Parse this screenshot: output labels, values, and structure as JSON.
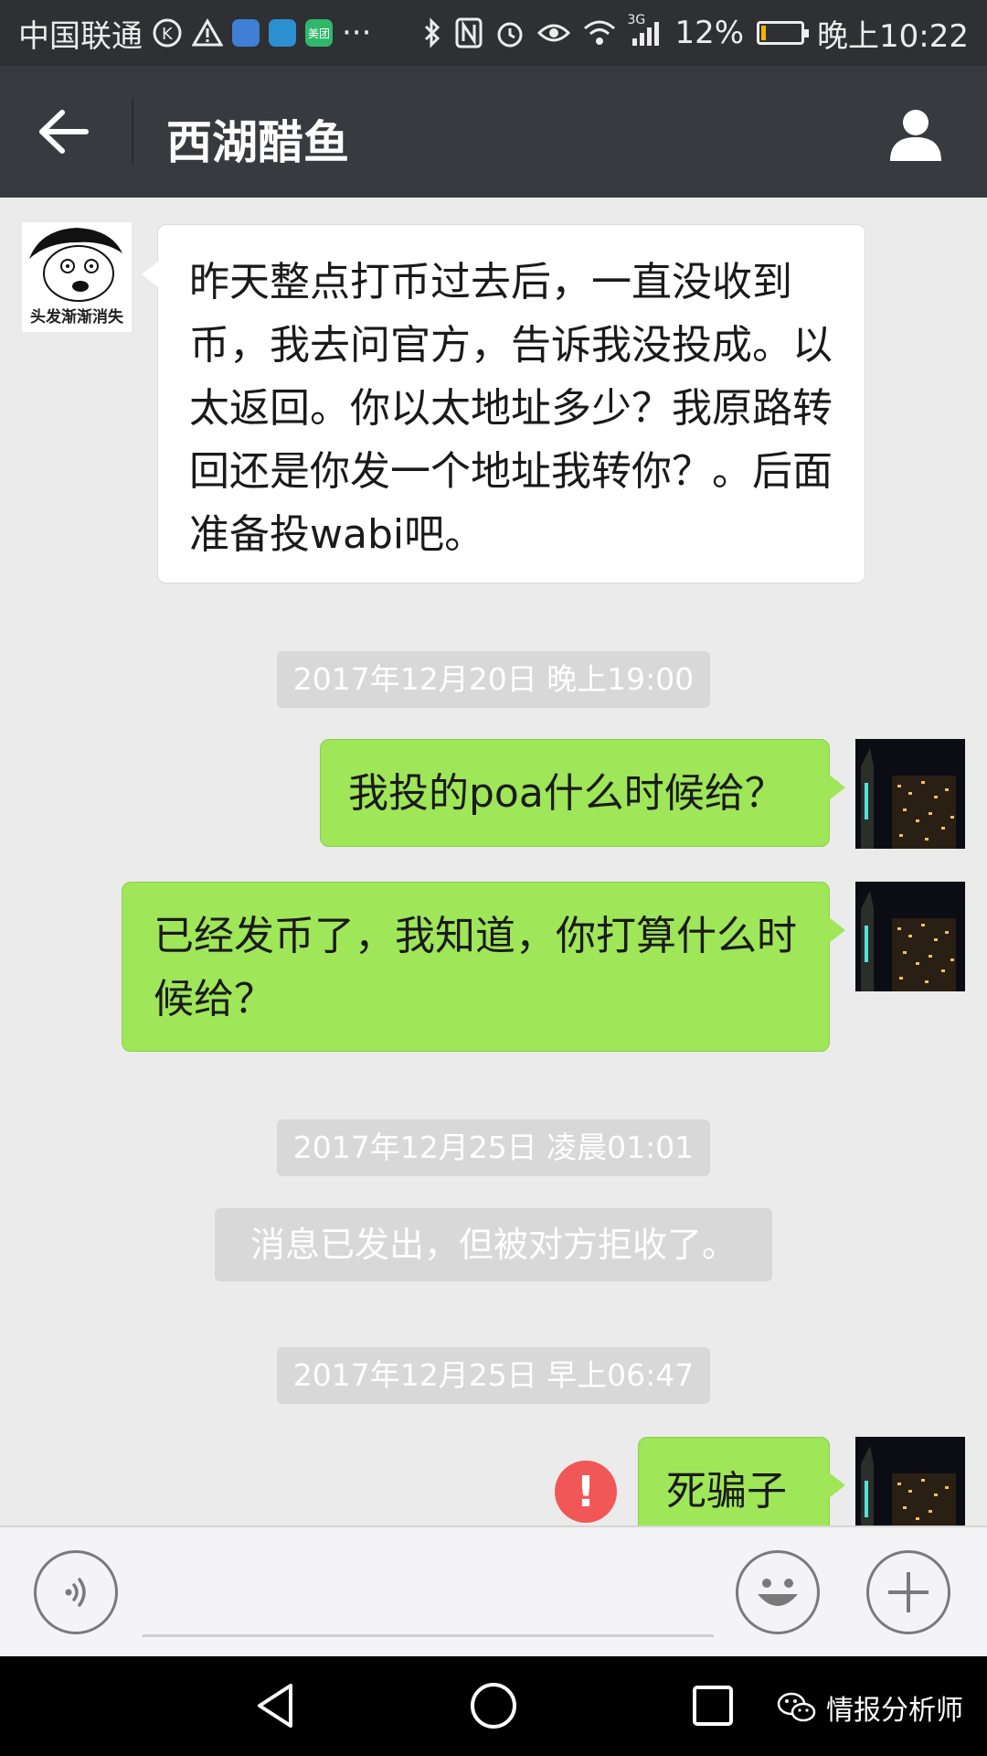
{
  "status_bar": {
    "carrier": "中国联通",
    "network": "3G",
    "battery": "12%",
    "time": "晚上10:22",
    "app_icon_meituan": "美团",
    "more_dots": "···",
    "battery_level_percent": 12,
    "battery_color": "#f0b400"
  },
  "header": {
    "title": "西湖醋鱼",
    "background": "#393a3f"
  },
  "messages": [
    {
      "direction": "in",
      "sender_avatar_caption": "头发渐渐消失",
      "text": "昨天整点打币过去后，一直没收到币，我去问官方，告诉我没投成。以太返回。你以太地址多少？我原路转回还是你发一个地址我转你？。后面准备投wabi吧。"
    },
    {
      "type": "timestamp",
      "text": "2017年12月20日 晚上19:00"
    },
    {
      "direction": "out",
      "text": "我投的poa什么时候给？"
    },
    {
      "direction": "out",
      "text": "已经发币了，我知道，你打算什么时候给？"
    },
    {
      "type": "timestamp",
      "text": "2017年12月25日 凌晨01:01"
    },
    {
      "type": "system",
      "text": "消息已发出，但被对方拒收了。"
    },
    {
      "type": "timestamp",
      "text": "2017年12月25日 早上06:47"
    },
    {
      "direction": "out",
      "text": "死骗子",
      "status": "failed",
      "status_icon": "!"
    }
  ],
  "input_bar": {
    "voice_icon": "voice-icon",
    "emoji_icon": "emoji-icon",
    "plus_icon": "plus-icon"
  },
  "nav_bar": {
    "watermark": "情报分析师"
  },
  "colors": {
    "outgoing_bubble": "#9fe658",
    "incoming_bubble": "#ffffff",
    "chat_background": "#ebebeb",
    "error_red": "#f25757"
  }
}
